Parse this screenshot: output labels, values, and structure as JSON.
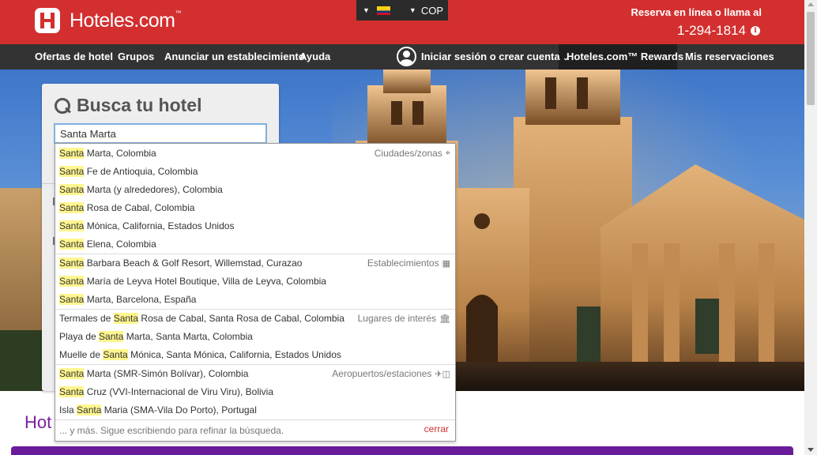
{
  "header": {
    "logo_text": "Hoteles.com",
    "logo_tm": "™",
    "currency": "COP",
    "reserve_text": "Reserva en línea o llama al",
    "phone": "1-294-1814",
    "info_glyph": "i"
  },
  "nav": {
    "items": [
      "Ofertas de hotel",
      "Grupos",
      "Anunciar un establecimiento",
      "Ayuda"
    ],
    "signin": "Iniciar sesión o crear cuenta",
    "rewards": "Hoteles.com™ Rewards",
    "reservations": "Mis reservaciones"
  },
  "search": {
    "title": "Busca tu hotel",
    "value": "Santa Marta"
  },
  "dropdown": {
    "groups": [
      {
        "category": "Ciudades/zonas",
        "icon": "crosshair-icon",
        "items": [
          {
            "hl": "Santa",
            "rest": " Marta, Colombia"
          },
          {
            "hl": "Santa",
            "rest": " Fe de Antioquia, Colombia"
          },
          {
            "hl": "Santa",
            "rest": " Marta (y alrededores), Colombia"
          },
          {
            "hl": "Santa",
            "rest": " Rosa de Cabal, Colombia"
          },
          {
            "hl": "Santa",
            "rest": " Mónica, California, Estados Unidos"
          },
          {
            "hl": "Santa",
            "rest": " Elena, Colombia"
          }
        ]
      },
      {
        "category": "Establecimientos",
        "icon": "building-icon",
        "items": [
          {
            "hl": "Santa",
            "rest": " Barbara Beach & Golf Resort, Willemstad, Curazao"
          },
          {
            "hl": "Santa",
            "rest": " María de Leyva Hotel Boutique, Villa de Leyva, Colombia"
          },
          {
            "hl": "Santa",
            "rest": " Marta, Barcelona, España"
          }
        ]
      },
      {
        "category": "Lugares de interés",
        "icon": "landmark-icon",
        "items": [
          {
            "pre": "Termales de ",
            "hl": "Santa",
            "rest": " Rosa de Cabal, Santa Rosa de Cabal, Colombia"
          },
          {
            "pre": "Playa de ",
            "hl": "Santa",
            "rest": " Marta, Santa Marta, Colombia"
          },
          {
            "pre": "Muelle de ",
            "hl": "Santa",
            "rest": " Mónica, Santa Mónica, California, Estados Unidos"
          }
        ]
      },
      {
        "category": "Aeropuertos/estaciones",
        "icon": "plane-bus-icon",
        "items": [
          {
            "hl": "Santa",
            "rest": " Marta (SMR-Simón Bolívar), Colombia"
          },
          {
            "hl": "Santa",
            "rest": " Cruz (VVI-Internacional de Viru Viru), Bolivia"
          },
          {
            "pre": "Isla ",
            "hl": "Santa",
            "rest": " Maria (SMA-Vila Do Porto), Portugal"
          }
        ]
      }
    ],
    "more_text": "... y más. Sigue escribiendo para refinar la búsqueda.",
    "close_text": "cerrar"
  },
  "bottom": {
    "title_partial": "Hot"
  },
  "colors": {
    "brand_red": "#d32f2f",
    "nav_dark": "#333333",
    "highlight": "#fff68f",
    "purple": "#6a1b9a"
  }
}
